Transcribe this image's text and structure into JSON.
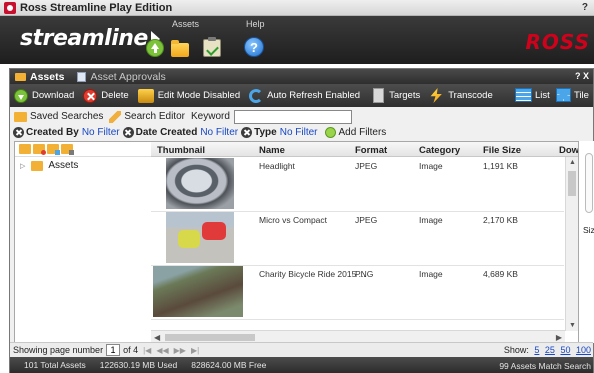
{
  "window": {
    "title": "Ross Streamline Play Edition",
    "help": "?"
  },
  "header": {
    "brand": "streamline",
    "assets_label": "Assets",
    "help_label": "Help",
    "help_glyph": "?",
    "company": "ROSS"
  },
  "panel": {
    "tabs": [
      {
        "label": "Assets",
        "active": true
      },
      {
        "label": "Asset Approvals",
        "active": false
      }
    ],
    "controls": "? X"
  },
  "toolbar": {
    "download": "Download",
    "delete": "Delete",
    "edit_mode": "Edit Mode Disabled",
    "auto_refresh": "Auto Refresh Enabled",
    "targets": "Targets",
    "transcode": "Transcode",
    "list": "List",
    "tile": "Tile"
  },
  "search": {
    "saved_searches": "Saved Searches",
    "search_editor": "Search Editor",
    "keyword_label": "Keyword",
    "keyword_value": ""
  },
  "filters": [
    {
      "label": "Created By",
      "value": "No Filter"
    },
    {
      "label": "Date Created",
      "value": "No Filter"
    },
    {
      "label": "Type",
      "value": "No Filter"
    }
  ],
  "add_filters": "Add Filters",
  "tree": {
    "root": "Assets"
  },
  "grid": {
    "columns": [
      "Thumbnail",
      "Name",
      "Format",
      "Category",
      "File Size",
      "Dow"
    ],
    "rows": [
      {
        "name": "Headlight",
        "format": "JPEG",
        "category": "Image",
        "size": "1,191 KB"
      },
      {
        "name": "Micro vs Compact",
        "format": "JPEG",
        "category": "Image",
        "size": "2,170 KB"
      },
      {
        "name": "Charity Bicycle Ride 2015 ...",
        "format": "PNG",
        "category": "Image",
        "size": "4,689 KB"
      }
    ]
  },
  "detail": {
    "size_label": "Size"
  },
  "paging": {
    "prefix": "Showing page number",
    "page": "1",
    "of": "of 4",
    "show_label": "Show:",
    "options": [
      "5",
      "25",
      "50",
      "100"
    ]
  },
  "status": {
    "total": "101 Total Assets",
    "used": "122630.19 MB Used",
    "free": "828624.00 MB Free",
    "match": "99 Assets Match Search"
  },
  "colors": {
    "accent_blue": "#1747c6",
    "ross_red": "#d0021b",
    "header_dark": "#2a2a2a"
  }
}
